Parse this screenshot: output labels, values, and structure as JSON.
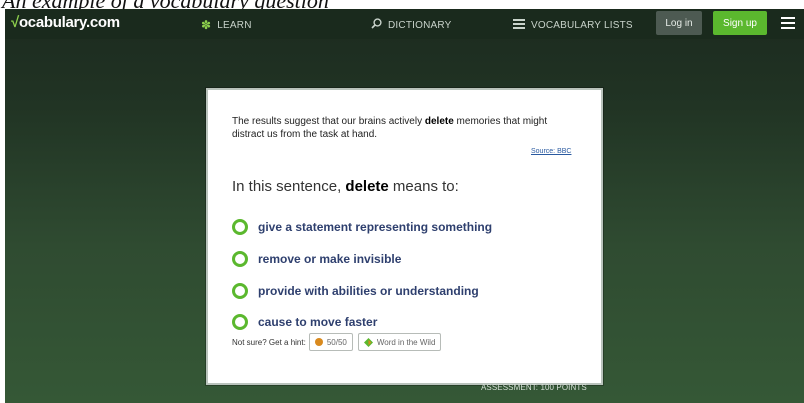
{
  "caption": "An example of a vocabulary question",
  "topbar": {
    "logo_check": "√",
    "logo_text": "ocabulary.com",
    "nav": [
      {
        "label": "LEARN",
        "icon": "learn-icon"
      },
      {
        "label": "DICTIONARY",
        "icon": "search-icon"
      },
      {
        "label": "VOCABULARY LISTS",
        "icon": "list-icon"
      }
    ],
    "login_label": "Log in",
    "signup_label": "Sign up"
  },
  "card": {
    "sentence_before": "The results suggest that our brains actively ",
    "sentence_word": "delete",
    "sentence_after": " memories that might distract us from the task at hand.",
    "source_label": "Source: BBC",
    "question_before": "In this sentence, ",
    "question_word": "delete",
    "question_after": " means to:",
    "options": [
      "give a statement representing something",
      "remove or make invisible",
      "provide with abilities or understanding",
      "cause to move faster"
    ],
    "hint_text": "Not sure? Get a hint:",
    "hint_fifty": "50/50",
    "hint_wild": "Word in the Wild"
  },
  "footer": {
    "assessment": "ASSESSMENT: 100 POINTS"
  },
  "colors": {
    "accent": "#5bb82e",
    "option_text": "#2e3f6e",
    "header_bg": "#1a2a1d"
  }
}
